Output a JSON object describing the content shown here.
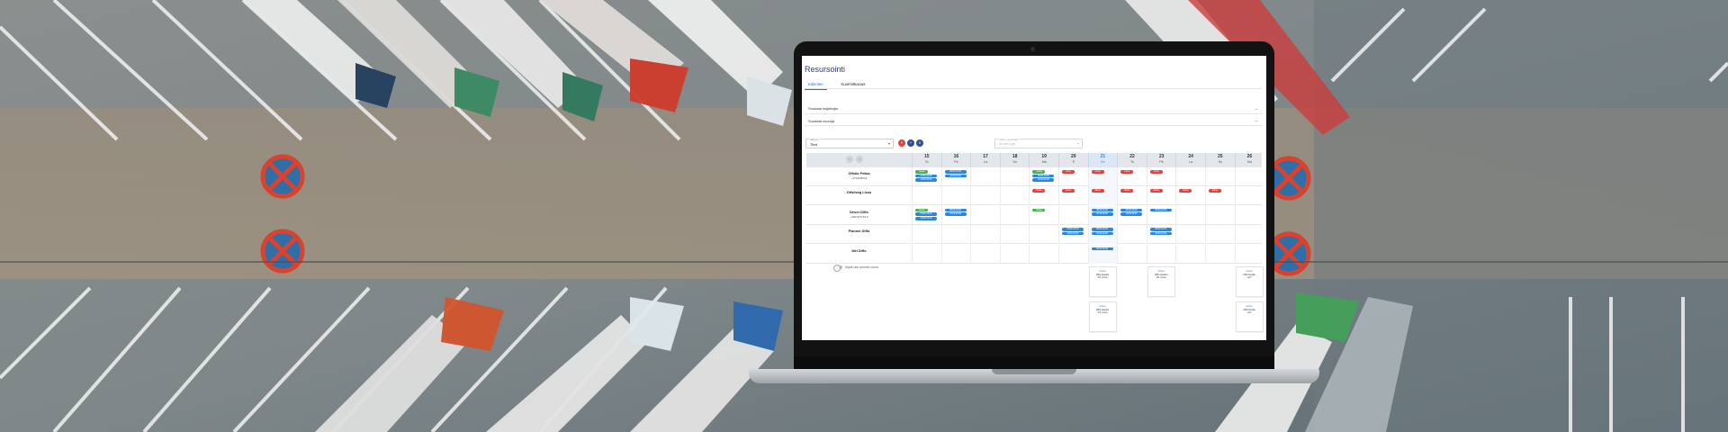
{
  "app": {
    "title": "Resursointi",
    "tabs": [
      {
        "label": "Kalenteri",
        "active": true
      },
      {
        "label": "Kuormittuvuus",
        "active": false
      }
    ],
    "accordions": [
      {
        "label": "Suodata kuljettajia"
      },
      {
        "label": "Suodata vuoroja"
      }
    ],
    "filter": {
      "select_label": "Näkymä",
      "select_value": "Tiimi",
      "date_label": "Valitse päivämäärä",
      "date_value": "dd.mm.yyyy"
    },
    "round_buttons": [
      {
        "glyph": "×",
        "color": "#e5423b"
      },
      {
        "glyph": "+",
        "color": "#2d4f9e"
      },
      {
        "glyph": "≡",
        "color": "#2d4f9e"
      }
    ],
    "days": [
      {
        "num": "15",
        "wd": "To"
      },
      {
        "num": "16",
        "wd": "Pe"
      },
      {
        "num": "17",
        "wd": "La"
      },
      {
        "num": "18",
        "wd": "Su"
      },
      {
        "num": "19",
        "wd": "Ma"
      },
      {
        "num": "20",
        "wd": "Ti"
      },
      {
        "num": "21",
        "wd": "Ke",
        "today": true
      },
      {
        "num": "22",
        "wd": "To"
      },
      {
        "num": "23",
        "wd": "Pe"
      },
      {
        "num": "24",
        "wd": "La"
      },
      {
        "num": "25",
        "wd": "Su"
      },
      {
        "num": "26",
        "wd": "Ma"
      }
    ],
    "rows": [
      {
        "name": "Offsite Pekka",
        "sub": "+37940/8015",
        "chips": [
          {
            "day": 0,
            "color": "green",
            "text": "Vapaa"
          },
          {
            "day": 0,
            "color": "blue",
            "text": "08:00-16:00"
          },
          {
            "day": 0,
            "color": "blue",
            "text": "16:00-22:00"
          },
          {
            "day": 1,
            "color": "blue",
            "text": "08:00-16:00"
          },
          {
            "day": 1,
            "color": "blue",
            "text": "16:00-22:00"
          },
          {
            "day": 4,
            "color": "green",
            "text": "Vapaa"
          },
          {
            "day": 4,
            "color": "blue",
            "text": "08:00-16:00"
          },
          {
            "day": 4,
            "color": "blue",
            "text": "16:00-22:00"
          },
          {
            "day": 5,
            "color": "red",
            "text": "Loma"
          },
          {
            "day": 6,
            "color": "red",
            "text": "Loma"
          },
          {
            "day": 7,
            "color": "red",
            "text": "Loma"
          },
          {
            "day": 8,
            "color": "red",
            "text": "Loma"
          }
        ]
      },
      {
        "name": "Offsiteeg Lissu",
        "sub": "",
        "chips": [
          {
            "day": 4,
            "color": "red",
            "text": "Sairas"
          },
          {
            "day": 5,
            "color": "red",
            "text": "Sairas"
          },
          {
            "day": 6,
            "color": "red",
            "text": "Sairas"
          },
          {
            "day": 7,
            "color": "red",
            "text": "Sairas"
          },
          {
            "day": 8,
            "color": "red",
            "text": "Sairas"
          },
          {
            "day": 9,
            "color": "red",
            "text": "Sairas"
          },
          {
            "day": 10,
            "color": "red",
            "text": "Sairas"
          }
        ]
      },
      {
        "name": "Driver Diffo",
        "sub": "+40076/7163.5",
        "chips": [
          {
            "day": 0,
            "color": "green",
            "text": "Vapaa"
          },
          {
            "day": 0,
            "color": "blue",
            "text": "08:00-16:00"
          },
          {
            "day": 0,
            "color": "blue",
            "text": "16:00-22:00"
          },
          {
            "day": 1,
            "color": "blue",
            "text": "08:00-16:00"
          },
          {
            "day": 1,
            "color": "blue",
            "text": "16:00-22:00"
          },
          {
            "day": 4,
            "color": "green",
            "text": "Vapaa"
          },
          {
            "day": 6,
            "color": "blue",
            "text": "08:00-16:00"
          },
          {
            "day": 6,
            "color": "blue",
            "text": "16:00-22:00"
          },
          {
            "day": 7,
            "color": "blue",
            "text": "08:00-16:00"
          },
          {
            "day": 7,
            "color": "blue",
            "text": "16:00-22:00"
          },
          {
            "day": 8,
            "color": "blue",
            "text": "08:00-16:00"
          }
        ]
      },
      {
        "name": "Planner Diffo",
        "sub": "",
        "chips": [
          {
            "day": 5,
            "color": "blue",
            "text": "08:00-16:00"
          },
          {
            "day": 5,
            "color": "blue",
            "text": "16:00-22:00"
          },
          {
            "day": 6,
            "color": "blue",
            "text": "08:00-16:00"
          },
          {
            "day": 6,
            "color": "blue",
            "text": "16:00-22:00"
          },
          {
            "day": 8,
            "color": "blue",
            "text": "08:00-16:00"
          },
          {
            "day": 8,
            "color": "blue",
            "text": "16:00-22:00"
          }
        ]
      },
      {
        "name": "Mel Diffo",
        "sub": "",
        "chips": [
          {
            "day": 6,
            "color": "blue",
            "text": "08:00-16:00"
          }
        ]
      }
    ],
    "footer": {
      "toggle_label": "Näytä vain avoimet vuorot"
    },
    "summaries": [
      {
        "day": 6,
        "slot": 0,
        "head": "Vuoro",
        "l1": "Diffo Ajoitset",
        "l2": "0/1 vuoro"
      },
      {
        "day": 6,
        "slot": 1,
        "head": "Vuoro",
        "l1": "Diffo Ajoitset",
        "l2": "0/1 vuoro"
      },
      {
        "day": 8,
        "slot": 0,
        "head": "Vuoro",
        "l1": "Diffo Ajoitset",
        "l2": "0/1 vuoro"
      },
      {
        "day": 11,
        "slot": 0,
        "head": "Vuoro",
        "l1": "Diffo Rivala",
        "l2": "+4/7"
      },
      {
        "day": 11,
        "slot": 1,
        "head": "Vuoro",
        "l1": "Diffo Rivala",
        "l2": "+4/7"
      }
    ]
  },
  "colors": {
    "accent": "#2f6fc6",
    "title": "#2a3a8c",
    "chip_blue": "#2f86d8",
    "chip_green": "#4bb04f",
    "chip_red": "#e5423b"
  }
}
